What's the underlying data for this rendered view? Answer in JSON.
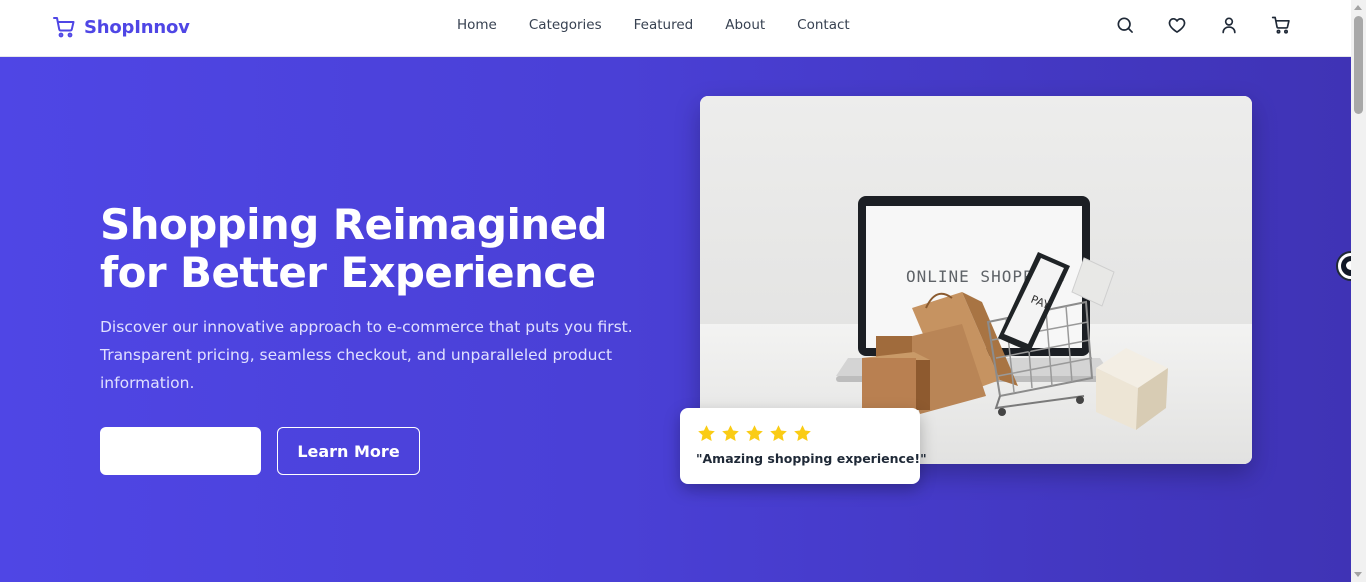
{
  "navbar": {
    "brand_name": "ShopInnov",
    "brand_icon": "cart-icon",
    "links": [
      {
        "label": "Home"
      },
      {
        "label": "Categories"
      },
      {
        "label": "Featured"
      },
      {
        "label": "About"
      },
      {
        "label": "Contact"
      }
    ],
    "icons": [
      "search-icon",
      "heart-icon",
      "user-icon",
      "cart-icon"
    ]
  },
  "hero": {
    "title_line1": "Shopping Reimagined",
    "title_line2": "for Better Experience",
    "description_lines": [
      "Discover our innovative approach to e-commerce that puts you first.",
      "Transparent pricing, seamless checkout, and unparalleled product",
      "information."
    ],
    "primary_button_label": "",
    "secondary_button_label": "Learn More",
    "image": {
      "screen_text": "ONLINE SHOPPING",
      "phone_text": "PAY"
    }
  },
  "review": {
    "rating": 5,
    "text": "\"Amazing shopping experience!\""
  },
  "colors": {
    "brand": "#4f46e5",
    "hero_gradient_start": "#4f46e5",
    "hero_gradient_end": "#3f33b5",
    "star": "#facc15",
    "nav_text": "#374151"
  }
}
